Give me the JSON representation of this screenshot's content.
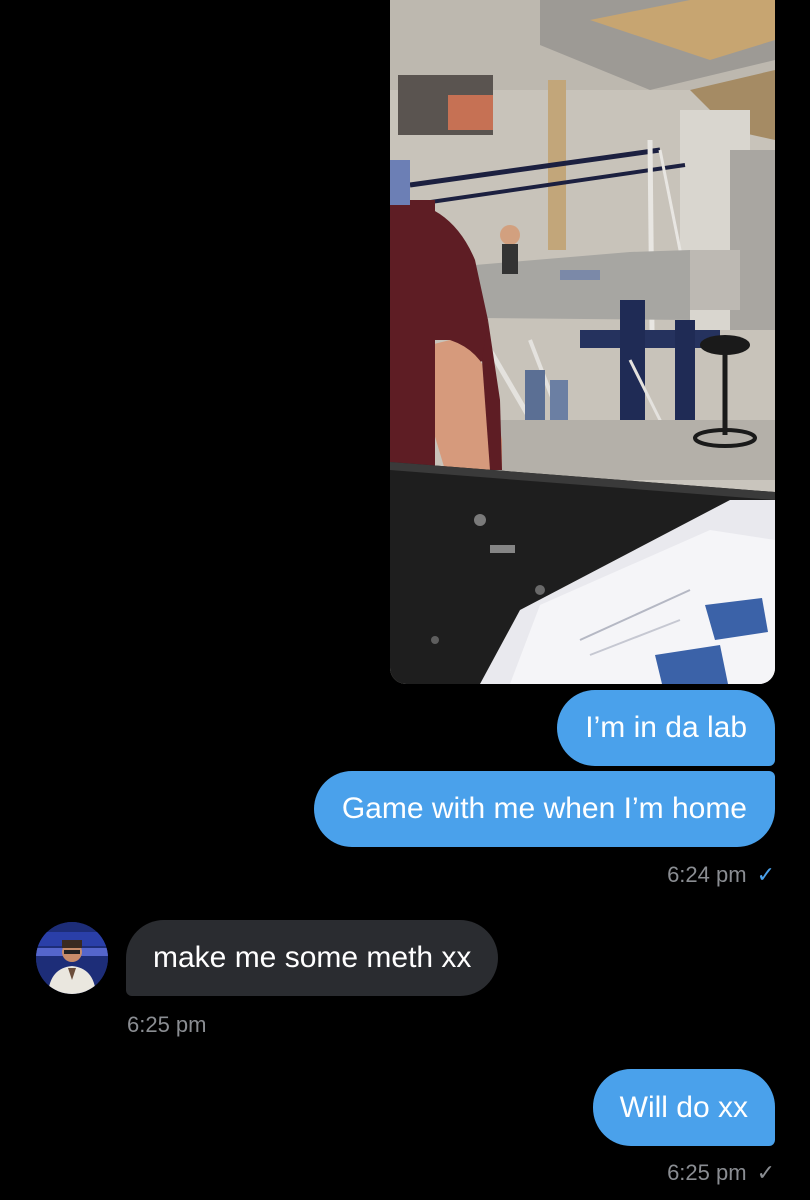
{
  "messages": [
    {
      "id": "m1",
      "direction": "outgoing",
      "type": "image",
      "description_icon": "photo-attachment"
    },
    {
      "id": "m2",
      "direction": "outgoing",
      "text": "I’m in da lab"
    },
    {
      "id": "m3",
      "direction": "outgoing",
      "text": "Game with me when I’m home"
    },
    {
      "id": "m4",
      "direction": "incoming",
      "text": "make me some meth xx"
    },
    {
      "id": "m5",
      "direction": "outgoing",
      "text": "Will do xx"
    }
  ],
  "timestamps": {
    "group1": "6:24 pm",
    "group2": "6:25 pm",
    "group3": "6:25 pm"
  },
  "status": {
    "group1": "read",
    "group3": "sent"
  },
  "icons": {
    "check": "✓"
  },
  "colors": {
    "background": "#000000",
    "outgoing_bubble": "#4aa1eb",
    "incoming_bubble": "#2a2c30",
    "timestamp": "#8a8d92",
    "read_check": "#4aa1eb",
    "sent_check": "#8a8d92"
  }
}
